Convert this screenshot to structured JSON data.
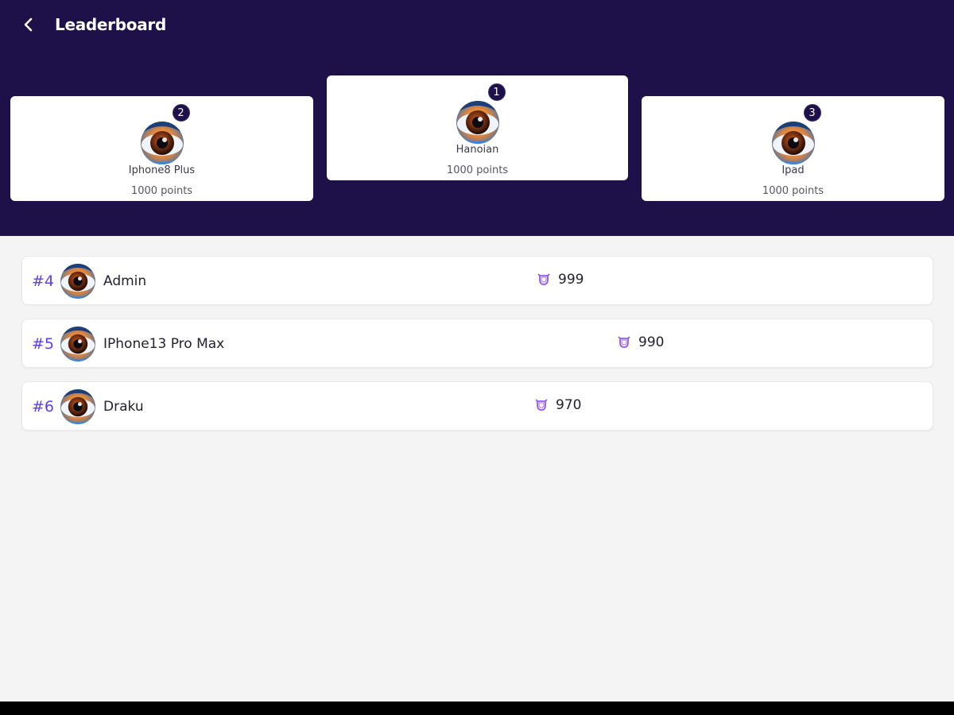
{
  "header": {
    "title": "Leaderboard",
    "back_icon": "chevron-left-icon",
    "background": "#1e1048"
  },
  "podium": {
    "first": {
      "rank": "1",
      "name": "Hanoian",
      "points": "1000 points"
    },
    "second": {
      "rank": "2",
      "name": "Iphone8 Plus",
      "points": "1000 points"
    },
    "third": {
      "rank": "3",
      "name": "Ipad",
      "points": "1000 points"
    }
  },
  "list": [
    {
      "rank": "#4",
      "name": "Admin",
      "score": "999"
    },
    {
      "rank": "#5",
      "name": "IPhone13 Pro Max",
      "score": "990"
    },
    {
      "rank": "#6",
      "name": "Draku",
      "score": "970"
    }
  ],
  "colors": {
    "accent": "#5a3ff0",
    "header_bg": "#1e1048",
    "score_icon": "#8a5cf0"
  },
  "icons": {
    "score": "trophy-cup-icon",
    "avatar": "eye-avatar"
  }
}
